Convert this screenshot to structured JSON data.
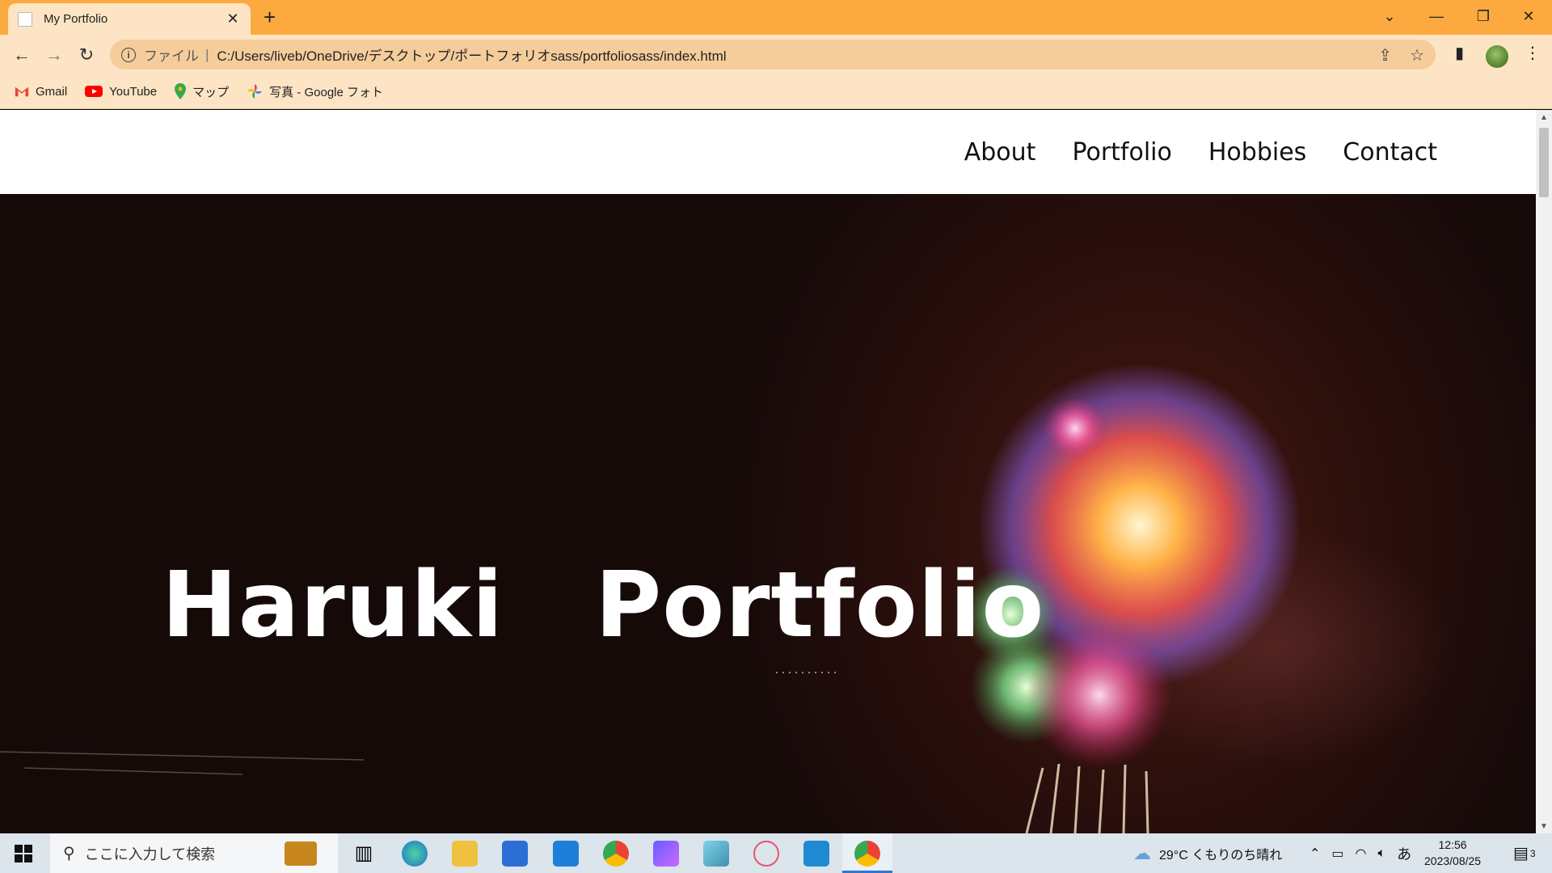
{
  "browser": {
    "tab_title": "My Portfolio",
    "url_scheme": "ファイル",
    "url": "C:/Users/liveb/OneDrive/デスクトップ/ポートフォリオsass/portfoliosass/index.html",
    "bookmarks": [
      {
        "label": "Gmail",
        "icon": "gmail-icon"
      },
      {
        "label": "YouTube",
        "icon": "youtube-icon"
      },
      {
        "label": "マップ",
        "icon": "maps-icon"
      },
      {
        "label": "写真 - Google フォト",
        "icon": "photos-icon"
      }
    ]
  },
  "site": {
    "nav": [
      "About",
      "Portfolio",
      "Hobbies",
      "Contact"
    ],
    "hero_title": "Haruki　Portfolio"
  },
  "taskbar": {
    "search_placeholder": "ここに入力して検索",
    "weather": "29°C  くもりのち晴れ",
    "ime": "あ",
    "time": "12:56",
    "date": "2023/08/25",
    "notifications": "3"
  },
  "colors": {
    "chrome_accent": "#fcaa3f",
    "toolbar": "#fce4c4"
  }
}
